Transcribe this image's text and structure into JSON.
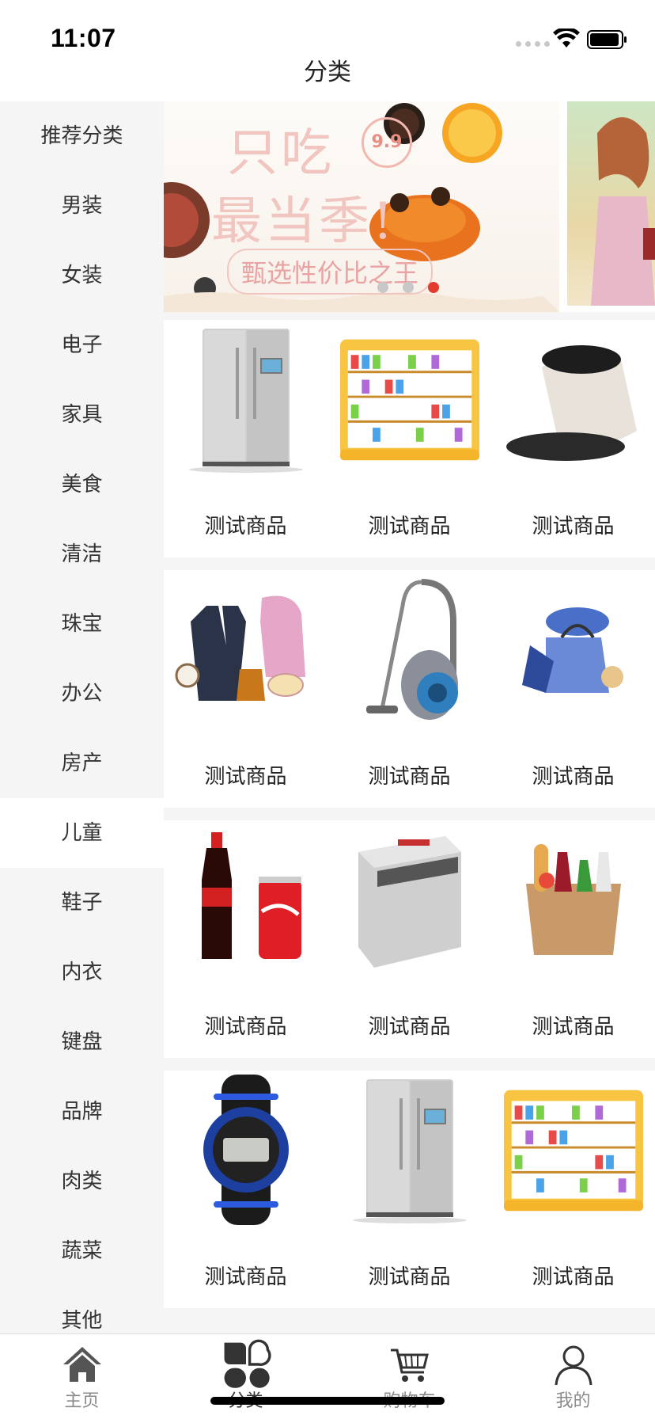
{
  "status_bar": {
    "time": "11:07"
  },
  "nav": {
    "title": "分类"
  },
  "sidebar": {
    "items": [
      {
        "label": "推荐分类"
      },
      {
        "label": "男装"
      },
      {
        "label": "女装"
      },
      {
        "label": "电子"
      },
      {
        "label": "家具"
      },
      {
        "label": "美食"
      },
      {
        "label": "清洁"
      },
      {
        "label": "珠宝"
      },
      {
        "label": "办公"
      },
      {
        "label": "房产"
      },
      {
        "label": "儿童"
      },
      {
        "label": "鞋子"
      },
      {
        "label": "内衣"
      },
      {
        "label": "键盘"
      },
      {
        "label": "品牌"
      },
      {
        "label": "肉类"
      },
      {
        "label": "蔬菜"
      },
      {
        "label": "其他"
      }
    ],
    "active_label": "儿童"
  },
  "banner": {
    "line1": "只吃",
    "line2": "最当季!",
    "line3": "甄选性价比之王",
    "badge": "9.9",
    "dots": 3,
    "active_dot": 3
  },
  "products": [
    {
      "name": "测试商品",
      "icon": "fridge-icon"
    },
    {
      "name": "测试商品",
      "icon": "shelf-icon"
    },
    {
      "name": "测试商品",
      "icon": "seed-sack-icon"
    },
    {
      "name": "测试商品",
      "icon": "clothes-icon"
    },
    {
      "name": "测试商品",
      "icon": "vacuum-icon"
    },
    {
      "name": "测试商品",
      "icon": "bag-hat-icon"
    },
    {
      "name": "测试商品",
      "icon": "cola-icon"
    },
    {
      "name": "测试商品",
      "icon": "appliance-icon"
    },
    {
      "name": "测试商品",
      "icon": "grocery-bag-icon"
    },
    {
      "name": "测试商品",
      "icon": "watch-icon"
    },
    {
      "name": "测试商品",
      "icon": "fridge-icon"
    },
    {
      "name": "测试商品",
      "icon": "shelf-icon"
    }
  ],
  "tabbar": {
    "tabs": [
      {
        "label": "主页",
        "icon": "home-icon"
      },
      {
        "label": "分类",
        "icon": "category-icon"
      },
      {
        "label": "购物车",
        "icon": "cart-icon"
      },
      {
        "label": "我的",
        "icon": "user-icon"
      }
    ],
    "active_color": "#333333",
    "inactive_color": "#8a8a8a"
  },
  "colors": {
    "accent_dot": "#e33b2e",
    "sidebar_bg": "#f5f5f5"
  }
}
